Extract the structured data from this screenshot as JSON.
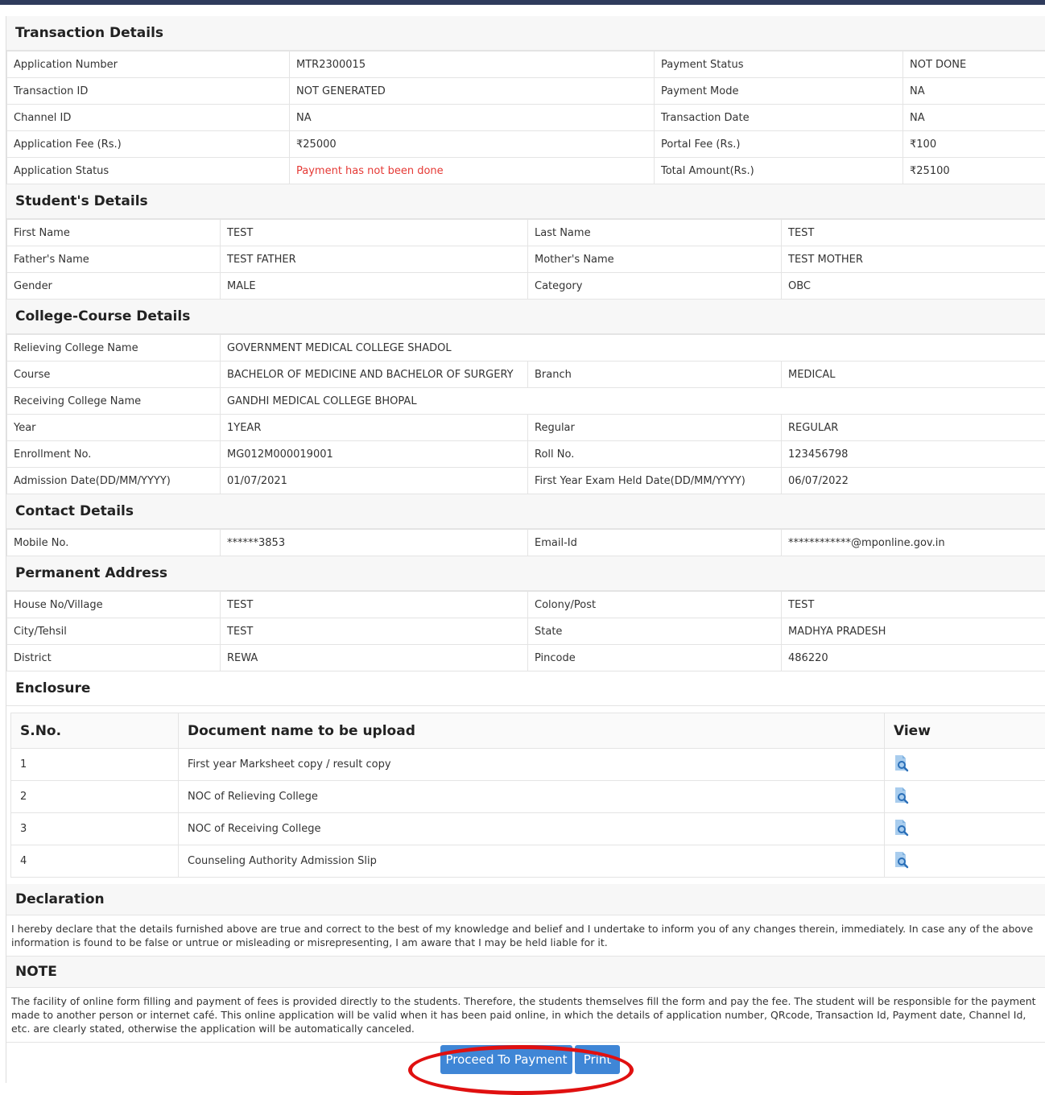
{
  "transaction": {
    "title": "Transaction Details",
    "rows": [
      [
        "Application Number",
        "MTR2300015",
        "Payment Status",
        "NOT DONE"
      ],
      [
        "Transaction ID",
        "NOT GENERATED",
        "Payment Mode",
        "NA"
      ],
      [
        "Channel ID",
        "NA",
        "Transaction Date",
        "NA"
      ],
      [
        "Application Fee (Rs.)",
        "₹25000",
        "Portal Fee (Rs.)",
        "₹100"
      ],
      [
        "Application Status",
        "Payment has not been done",
        "Total Amount(Rs.)",
        "₹25100"
      ]
    ]
  },
  "student": {
    "title": "Student's Details",
    "rows": [
      [
        "First Name",
        "TEST",
        "Last Name",
        "TEST"
      ],
      [
        "Father's Name",
        "TEST FATHER",
        "Mother's Name",
        "TEST MOTHER"
      ],
      [
        "Gender",
        "MALE",
        "Category",
        "OBC"
      ]
    ]
  },
  "college": {
    "title": "College-Course Details",
    "relieving_label": "Relieving College Name",
    "relieving_value": "GOVERNMENT MEDICAL COLLEGE SHADOL",
    "course": [
      "Course",
      "BACHELOR OF MEDICINE AND BACHELOR OF SURGERY",
      "Branch",
      "MEDICAL"
    ],
    "receiving_label": "Receiving College Name",
    "receiving_value": "GANDHI MEDICAL COLLEGE BHOPAL",
    "rows": [
      [
        "Year",
        "1YEAR",
        "Regular",
        "REGULAR"
      ],
      [
        "Enrollment No.",
        "MG012M000019001",
        "Roll No.",
        "123456798"
      ],
      [
        "Admission Date(DD/MM/YYYY)",
        "01/07/2021",
        "First Year Exam Held Date(DD/MM/YYYY)",
        "06/07/2022"
      ]
    ]
  },
  "contact": {
    "title": "Contact Details",
    "rows": [
      [
        "Mobile No.",
        "******3853",
        "Email-Id",
        "************@mponline.gov.in"
      ]
    ]
  },
  "address": {
    "title": "Permanent Address",
    "rows": [
      [
        "House No/Village",
        "TEST",
        "Colony/Post",
        "TEST"
      ],
      [
        "City/Tehsil",
        "TEST",
        "State",
        "MADHYA PRADESH"
      ],
      [
        "District",
        "REWA",
        "Pincode",
        "486220"
      ]
    ]
  },
  "enclosure": {
    "title": "Enclosure",
    "headers": [
      "S.No.",
      "Document name to be upload",
      "View"
    ],
    "rows": [
      [
        "1",
        "First year Marksheet copy / result copy"
      ],
      [
        "2",
        "NOC of Relieving College"
      ],
      [
        "3",
        "NOC of Receiving College"
      ],
      [
        "4",
        "Counseling Authority Admission Slip"
      ]
    ],
    "view_icon": "view-document-icon"
  },
  "declaration": {
    "title": "Declaration",
    "text": "I hereby declare that the details furnished above are true and correct to the best of my knowledge and belief and I undertake to inform you of any changes therein, immediately. In case any of the above information is found to be false or untrue or misleading or misrepresenting, I am aware that I may be held liable for it."
  },
  "note": {
    "title": "NOTE",
    "text": "The facility of online form filling and payment of fees is provided directly to the students. Therefore, the students themselves fill the form and pay the fee. The student will be responsible for the payment made to another person or internet café. This online application will be valid when it has been paid online, in which the details of application number, QRcode, Transaction Id, Payment date, Channel Id, etc. are clearly stated, otherwise the application will be automatically canceled."
  },
  "buttons": {
    "proceed": "Proceed To Payment",
    "print": "Print"
  },
  "colors": {
    "accent": "#3f86d6",
    "error_text": "#e53935",
    "highlight_ring": "#e01010",
    "top_bar": "#2f3b5c"
  }
}
